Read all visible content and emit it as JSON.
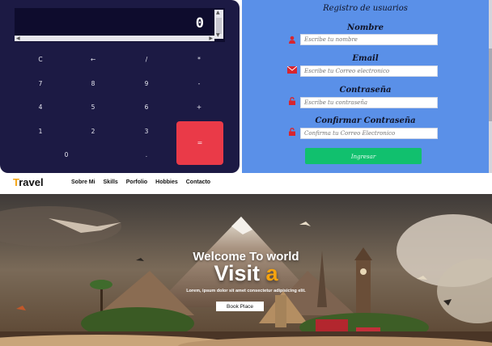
{
  "calculator": {
    "display": "0",
    "rows": [
      [
        "C",
        "←",
        "/",
        "*"
      ],
      [
        "7",
        "8",
        "9",
        "-"
      ],
      [
        "4",
        "5",
        "6",
        "+"
      ],
      [
        "1",
        "2",
        "3"
      ],
      [
        "0",
        "."
      ]
    ],
    "equals": "=",
    "equals_color": "#ea3a48"
  },
  "register": {
    "title": "Registro de usuarios",
    "fields": [
      {
        "label": "Nombre",
        "placeholder": "Escribe tu nombre",
        "icon": "user-icon"
      },
      {
        "label": "Email",
        "placeholder": "Escribe tu Correo electronico",
        "icon": "envelope-icon"
      },
      {
        "label": "Contraseña",
        "placeholder": "Escribe tu contraseña",
        "icon": "lock-icon"
      },
      {
        "label": "Confirmar Contraseña",
        "placeholder": "Confirma tu Correo Electronico",
        "icon": "lock-icon"
      }
    ],
    "submit": "Ingresar",
    "submit_color": "#11c06e"
  },
  "travel": {
    "brand_first": "T",
    "brand_rest": "ravel",
    "nav": [
      "Sobre Mi",
      "Skills",
      "Porfolio",
      "Hobbies",
      "Contacto"
    ],
    "hero_sub": "Welcome To world",
    "hero_title_main": "Visit ",
    "hero_title_accent": "a",
    "hero_text": "Lorem, ipsum dolor sit amet consectetur adipisicing elit.",
    "book_button": "Book Place",
    "accent_color": "#f5a30e"
  }
}
